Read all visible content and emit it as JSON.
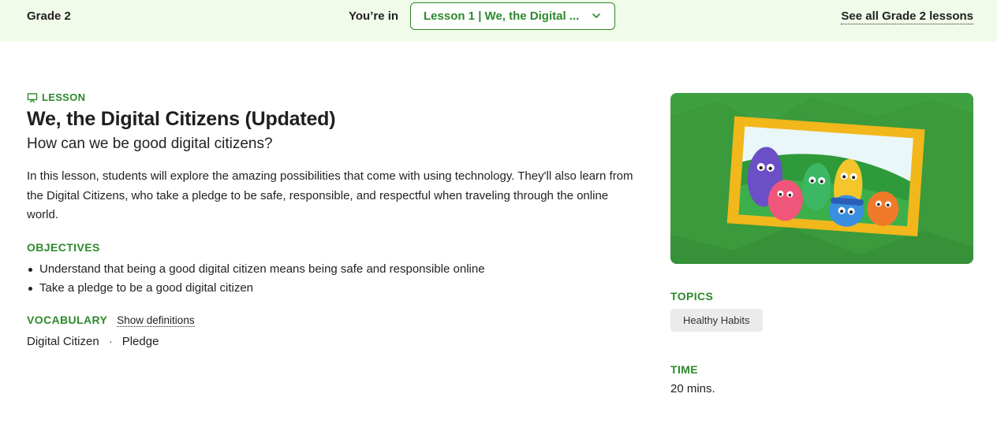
{
  "header": {
    "grade": "Grade 2",
    "youre_in": "You’re in",
    "lesson_select": "Lesson 1 | We, the Digital ...",
    "see_all": "See all Grade 2 lessons"
  },
  "lesson": {
    "eyebrow": "LESSON",
    "title": "We, the Digital Citizens (Updated)",
    "subtitle": "How can we be good digital citizens?",
    "description": "In this lesson, students will explore the amazing possibilities that come with using technology. They'll also learn from the Digital Citizens, who take a pledge to be safe, responsible, and respectful when traveling through the online world.",
    "objectives_heading": "OBJECTIVES",
    "objectives": [
      "Understand that being a good digital citizen means being safe and responsible online",
      "Take a pledge to be a good digital citizen"
    ],
    "vocabulary_heading": "VOCABULARY",
    "show_definitions": "Show definitions",
    "vocabulary": [
      "Digital Citizen",
      "Pledge"
    ],
    "separator": "·"
  },
  "sidebar": {
    "topics_heading": "TOPICS",
    "topics": [
      "Healthy Habits"
    ],
    "time_heading": "TIME",
    "time": "20 mins."
  },
  "colors": {
    "accent": "#2c8a2c",
    "header_bg": "#f1fbe9",
    "hero_green": "#3a9a3c",
    "frame_gold": "#f2b71b"
  },
  "icons": {
    "eyebrow": "presentation-board-icon",
    "dropdown": "chevron-down-icon"
  }
}
